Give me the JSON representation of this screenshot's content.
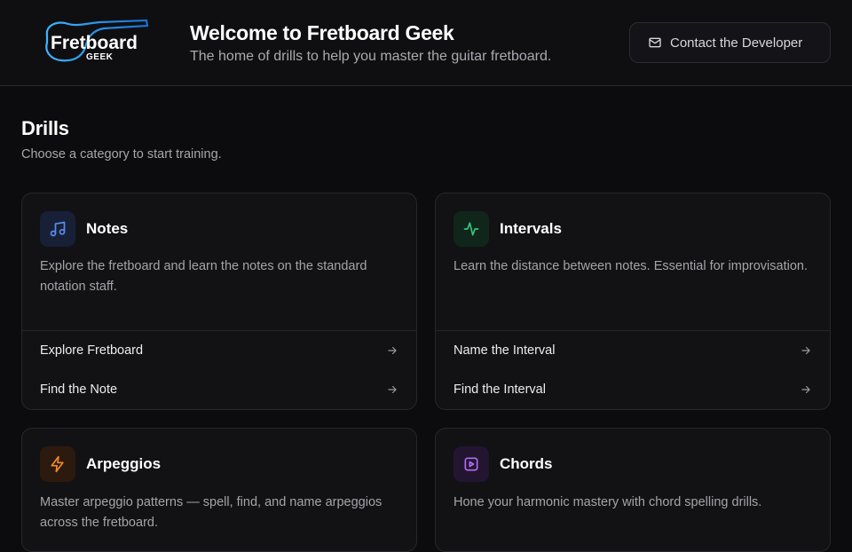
{
  "header": {
    "logo": {
      "wordmark": "Fretboard",
      "submark": "GEEK"
    },
    "title": "Welcome to Fretboard Geek",
    "subtitle": "The home of drills to help you master the guitar fretboard.",
    "contact_button": {
      "label": "Contact the Developer",
      "icon": "mail-icon"
    }
  },
  "drills": {
    "title": "Drills",
    "subtitle": "Choose a category to start training.",
    "cards": [
      {
        "title": "Notes",
        "icon": "music-note-icon",
        "accent": "#5b8def",
        "icon_bg": "#172036",
        "description": "Explore the fretboard and learn the notes on the standard notation staff.",
        "links": [
          "Explore Fretboard",
          "Find the Note"
        ]
      },
      {
        "title": "Intervals",
        "icon": "activity-icon",
        "accent": "#34c77b",
        "icon_bg": "#10261b",
        "description": "Learn the distance between notes. Essential for improvisation.",
        "links": [
          "Name the Interval",
          "Find the Interval"
        ]
      },
      {
        "title": "Arpeggios",
        "icon": "zap-icon",
        "accent": "#f08a2c",
        "icon_bg": "#2d1a0e",
        "description": "Master arpeggio patterns — spell, find, and name arpeggios across the fretboard.",
        "links": []
      },
      {
        "title": "Chords",
        "icon": "play-square-icon",
        "accent": "#b06cf2",
        "icon_bg": "#23152f",
        "description": "Hone your harmonic mastery with chord spelling drills.",
        "links": []
      }
    ]
  }
}
